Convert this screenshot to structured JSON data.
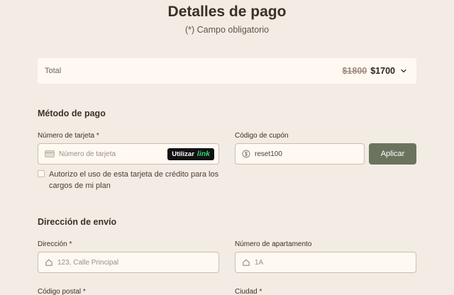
{
  "header": {
    "title": "Detalles de pago",
    "subtitle": "(*) Campo obligatorio"
  },
  "total": {
    "label": "Total",
    "old_price": "$1800",
    "new_price": "$1700",
    "toggle_icon": "chevron-down-icon"
  },
  "payment": {
    "section_title": "Método de pago",
    "card_label": "Número de tarjeta *",
    "card_placeholder": "Número de tarjeta",
    "card_value": "",
    "link_prefix": "Utilizar",
    "link_brand": "link",
    "coupon_label": "Código de cupón",
    "coupon_value": "reset100",
    "coupon_placeholder": "",
    "apply_label": "Aplicar",
    "authorize_text": "Autorizo el uso de esta tarjeta de crédito para los cargos de mi plan",
    "authorize_checked": false
  },
  "shipping": {
    "section_title": "Dirección de envío",
    "address_label": "Dirección *",
    "address_placeholder": "123, Calle Principal",
    "apartment_label": "Número de apartamento",
    "apartment_placeholder": "1A",
    "postal_label": "Código postal *",
    "city_label": "Ciudad *"
  },
  "colors": {
    "background": "#f3ece4",
    "card": "#fff9f2",
    "accent_button": "#6b735f",
    "link_button": "#111111",
    "link_brand": "#2fd57a"
  }
}
